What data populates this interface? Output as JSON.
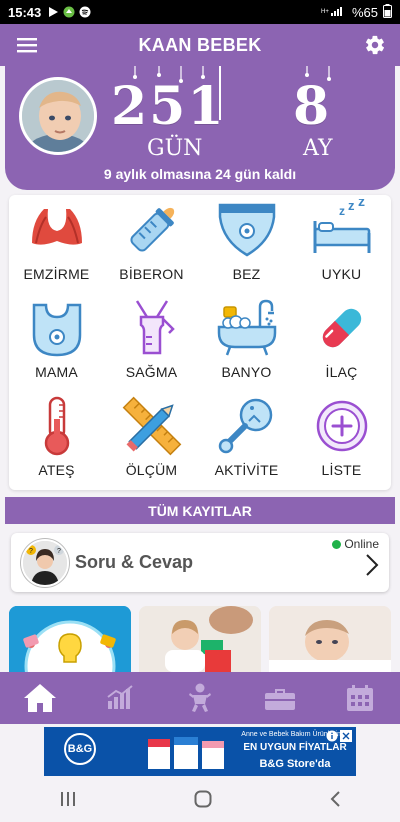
{
  "status_bar": {
    "time": "15:43",
    "battery": "%65"
  },
  "header": {
    "title": "KAAN BEBEK"
  },
  "hero": {
    "days_value": "251",
    "days_unit": "GÜN",
    "months_value": "8",
    "months_unit": "AY",
    "remaining_text": "9 aylık olmasına 24 gün kaldı"
  },
  "activities": [
    {
      "label": "EMZİRME",
      "icon": "bra-icon"
    },
    {
      "label": "BİBERON",
      "icon": "baby-bottle-icon"
    },
    {
      "label": "BEZ",
      "icon": "diaper-icon"
    },
    {
      "label": "UYKU",
      "icon": "sleep-bed-icon"
    },
    {
      "label": "MAMA",
      "icon": "bib-icon"
    },
    {
      "label": "SAĞMA",
      "icon": "breast-pump-icon"
    },
    {
      "label": "BANYO",
      "icon": "bathtub-icon"
    },
    {
      "label": "İLAÇ",
      "icon": "pill-icon"
    },
    {
      "label": "ATEŞ",
      "icon": "thermometer-icon"
    },
    {
      "label": "ÖLÇÜM",
      "icon": "ruler-pencil-icon"
    },
    {
      "label": "AKTİVİTE",
      "icon": "rattle-icon"
    },
    {
      "label": "LİSTE",
      "icon": "plus-circle-icon"
    }
  ],
  "all_records": {
    "label": "TÜM KAYITLAR"
  },
  "qa_card": {
    "title": "Soru & Cevap",
    "status": "Online"
  },
  "bottom_nav": [
    "home-icon",
    "chart-icon",
    "baby-icon",
    "toolbox-icon",
    "calendar-icon"
  ],
  "ad": {
    "brand": "B&G",
    "tagline": "Anne ve Bebek Bakım Ürünlerinde",
    "headline": "EN UYGUN FİYATLAR",
    "store": "B&G Store'da"
  },
  "colors": {
    "primary": "#8c64b2",
    "online": "#20b24a"
  }
}
